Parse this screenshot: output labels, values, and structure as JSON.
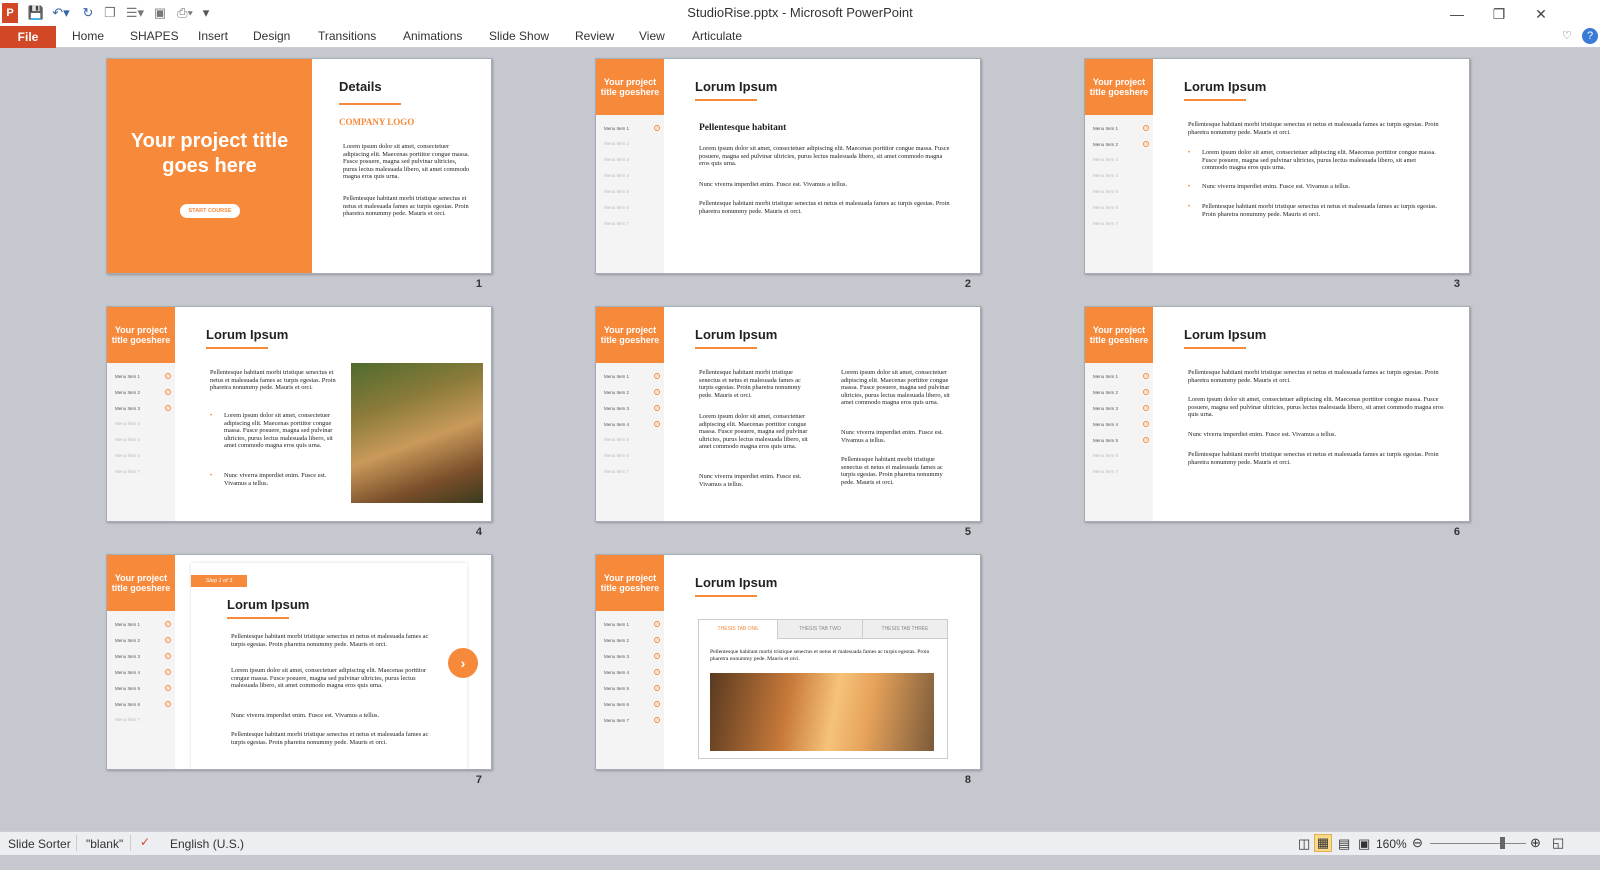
{
  "window": {
    "title": "StudioRise.pptx  -  Microsoft PowerPoint"
  },
  "colors": {
    "accent": "#f7893a",
    "file_tab": "#d24726",
    "background": "#c5c8cf"
  },
  "ribbon": {
    "file": "File",
    "tabs": [
      "Home",
      "SHAPES",
      "Insert",
      "Design",
      "Transitions",
      "Animations",
      "Slide Show",
      "Review",
      "View",
      "Articulate"
    ]
  },
  "slides": {
    "common": {
      "side_title": "Your project title goeshere",
      "heading": "Lorum Ipsum",
      "menu": [
        "Menu Item 1",
        "Menu Item 2",
        "Menu Item 3",
        "Menu Item 4",
        "Menu Item 5",
        "Menu Item 6",
        "Menu Item 7"
      ],
      "para_a": "Pellentesque habitant morbi tristique senectus et netus et malesuada fames ac turpis egestas. Proin pharetra nonummy pede. Mauris et orci.",
      "para_b": "Lorem ipsum dolor sit amet, consectetuer adipiscing elit. Maecenas porttitor congue massa. Fusce posuere, magna sed pulvinar ultricies, purus lectus malesuada libero, sit amet commodo magna eros quis urna.",
      "para_c": "Nunc viverra imperdiet enim. Fusce est. Vivamus a tellus."
    },
    "s1": {
      "title": "Your project title goes here",
      "button": "START COURSE",
      "details": "Details",
      "logo": "COMPANY LOGO",
      "number": "1"
    },
    "s2": {
      "subheading": "Pellentesque habitant",
      "number": "2"
    },
    "s3": {
      "number": "3"
    },
    "s4": {
      "number": "4"
    },
    "s5": {
      "number": "5"
    },
    "s6": {
      "number": "6"
    },
    "s7": {
      "step": "Step 1 of 3",
      "number": "7"
    },
    "s8": {
      "tabs": [
        "THESIS TAB ONE",
        "THESIS TAB TWO",
        "THESIS TAB THREE"
      ],
      "number": "8"
    }
  },
  "status": {
    "view": "Slide Sorter",
    "theme": "\"blank\"",
    "language": "English (U.S.)",
    "zoom": "160%"
  }
}
